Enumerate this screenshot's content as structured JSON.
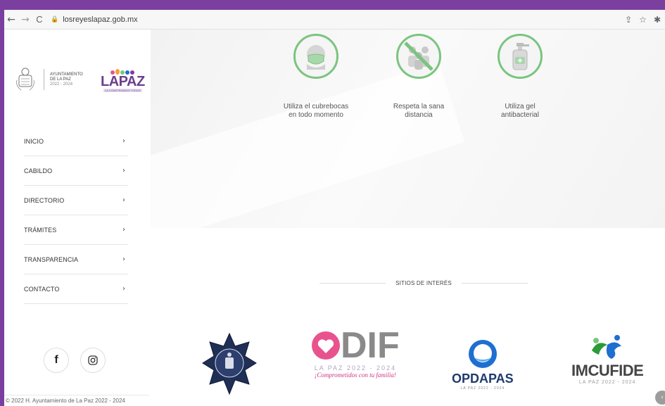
{
  "browser": {
    "back_icon": "←",
    "forward_icon": "→",
    "reload_icon": "C",
    "url": "losreyeslapaz.gob.mx",
    "share_icon": "⇪",
    "star_icon": "☆",
    "ext_icon": "✱"
  },
  "sidebar": {
    "ayuntamiento_line1": "AYUNTAMIENTO",
    "ayuntamiento_line2": "DE LA PAZ",
    "ayuntamiento_years": "2022 - 2024",
    "brand_name": "LAPAZ",
    "brand_tagline": "LA CONSTRUIMOS TODOS",
    "menu": [
      {
        "label": "INICIO",
        "chevron": "›"
      },
      {
        "label": "CABILDO",
        "chevron": "›"
      },
      {
        "label": "DIRECTORIO",
        "chevron": "›"
      },
      {
        "label": "TRÁMITES",
        "chevron": "›"
      },
      {
        "label": "TRANSPARENCIA",
        "chevron": "›"
      },
      {
        "label": "CONTACTO",
        "chevron": "›"
      }
    ],
    "social": {
      "facebook": "f"
    },
    "footer": "© 2022 H. Ayuntamiento de La Paz 2022 - 2024"
  },
  "banner": {
    "items": [
      {
        "line1": "Utiliza el cubrebocas",
        "line2": "en todo momento"
      },
      {
        "line1": "Respeta la sana",
        "line2": "distancia"
      },
      {
        "line1": "Utiliza gel",
        "line2": "antibacterial"
      }
    ]
  },
  "sites": {
    "title": "SITIOS DE INTERÉS",
    "dif": {
      "word": "DIF",
      "year": "LA PAZ 2022 - 2024",
      "slogan": "¡Comprometidos con tu familia!"
    },
    "opdapas": {
      "word": "OPDAPAS",
      "year": "LA PAZ 2022 - 2024"
    },
    "imcufide": {
      "word": "IMCUFIDE",
      "year": "LA PAZ 2022 - 2024"
    }
  },
  "colors": {
    "brand_purple": "#7b3fa0",
    "hygiene_green": "#7bc47f",
    "dif_pink": "#e8538f",
    "opdapas_blue": "#1e6fd0"
  }
}
